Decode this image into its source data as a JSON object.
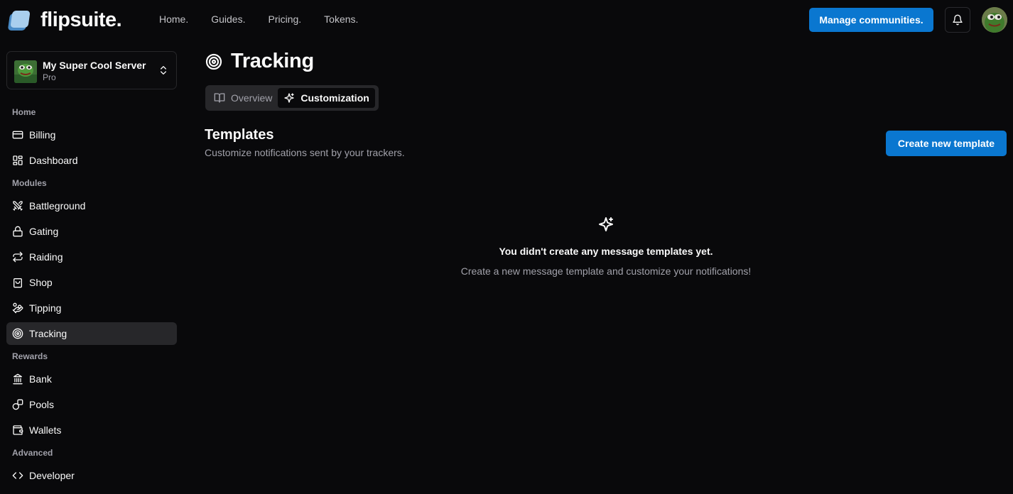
{
  "header": {
    "logo_text": "flipsuite.",
    "nav": [
      "Home.",
      "Guides.",
      "Pricing.",
      "Tokens."
    ],
    "manage_label": "Manage communities."
  },
  "server": {
    "name": "My Super Cool Server",
    "plan": "Pro"
  },
  "sidebar": {
    "sections": {
      "home": "Home",
      "modules": "Modules",
      "rewards": "Rewards",
      "advanced": "Advanced"
    },
    "items": [
      {
        "label": "Billing",
        "icon": "credit-card-icon"
      },
      {
        "label": "Dashboard",
        "icon": "dashboard-icon"
      },
      {
        "label": "Battleground",
        "icon": "swords-icon"
      },
      {
        "label": "Gating",
        "icon": "lock-icon"
      },
      {
        "label": "Raiding",
        "icon": "repeat-icon"
      },
      {
        "label": "Shop",
        "icon": "shopping-bag-icon"
      },
      {
        "label": "Tipping",
        "icon": "hand-coins-icon"
      },
      {
        "label": "Tracking",
        "icon": "target-icon",
        "active": true
      },
      {
        "label": "Bank",
        "icon": "bank-icon"
      },
      {
        "label": "Pools",
        "icon": "pools-icon"
      },
      {
        "label": "Wallets",
        "icon": "wallet-icon"
      },
      {
        "label": "Developer",
        "icon": "code-icon"
      }
    ]
  },
  "main": {
    "title": "Tracking",
    "tabs": [
      {
        "label": "Overview",
        "icon": "book-open-icon"
      },
      {
        "label": "Customization",
        "icon": "sparkles-icon",
        "active": true
      }
    ],
    "section_title": "Templates",
    "section_subtitle": "Customize notifications sent by your trackers.",
    "create_label": "Create new template",
    "empty_title": "You didn't create any message templates yet.",
    "empty_desc": "Create a new message template and customize your notifications!"
  },
  "colors": {
    "accent": "#0a77d0",
    "background": "#09090b",
    "active_item": "#27272a"
  }
}
